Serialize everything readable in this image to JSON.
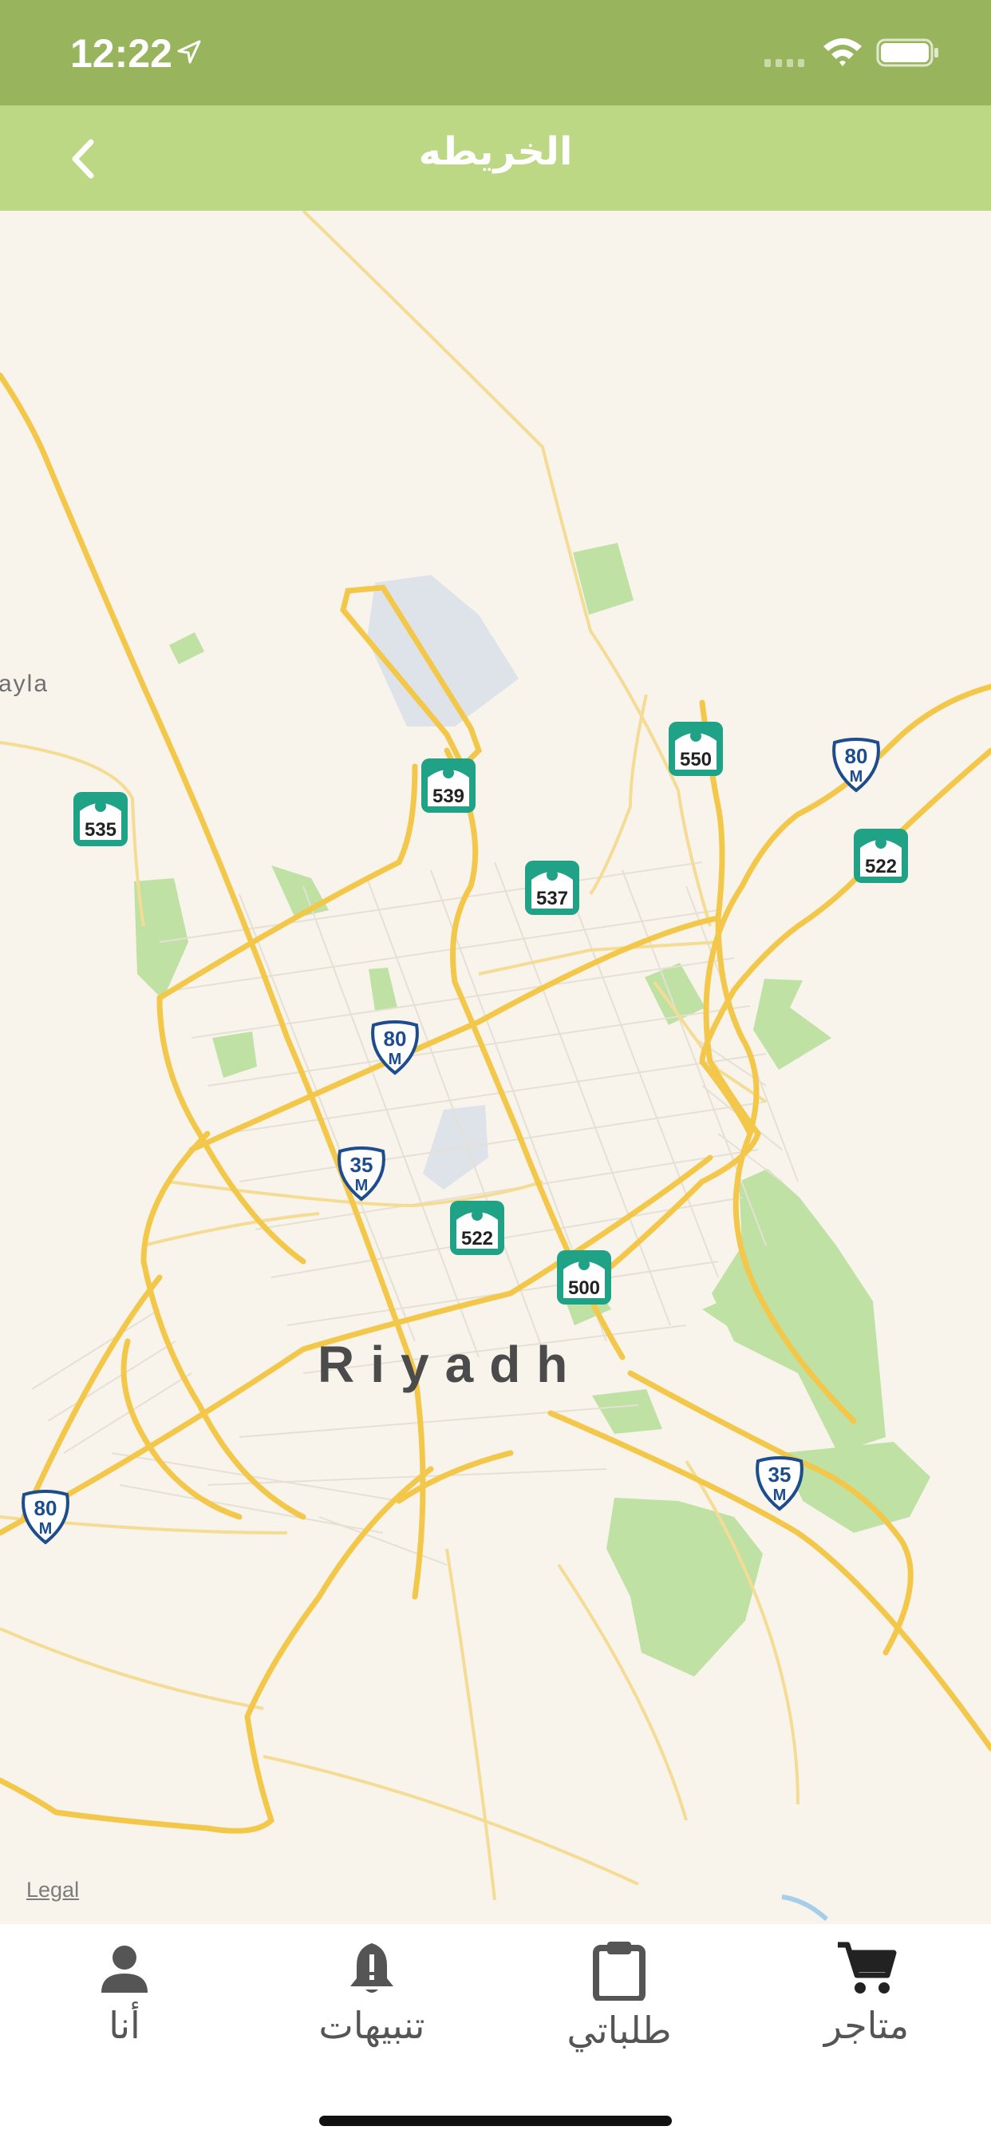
{
  "status_bar": {
    "time": "12:22"
  },
  "header": {
    "title": "الخريطه"
  },
  "map": {
    "city_label": "Riyadh",
    "place_label": "ayla",
    "legal_link": "Legal",
    "road_markers": [
      "539",
      "550",
      "535",
      "537",
      "522",
      "522",
      "500"
    ],
    "highway_shields": [
      {
        "number": "80",
        "suffix": "M"
      },
      {
        "number": "80",
        "suffix": "M"
      },
      {
        "number": "35",
        "suffix": "M"
      },
      {
        "number": "35",
        "suffix": "M"
      },
      {
        "number": "80",
        "suffix": "M"
      }
    ]
  },
  "tabs": [
    {
      "label": "أنا",
      "icon": "person-icon"
    },
    {
      "label": "تنبيهات",
      "icon": "bell-icon"
    },
    {
      "label": "طلباتي",
      "icon": "clipboard-icon"
    },
    {
      "label": "متاجر",
      "icon": "cart-icon"
    }
  ]
}
